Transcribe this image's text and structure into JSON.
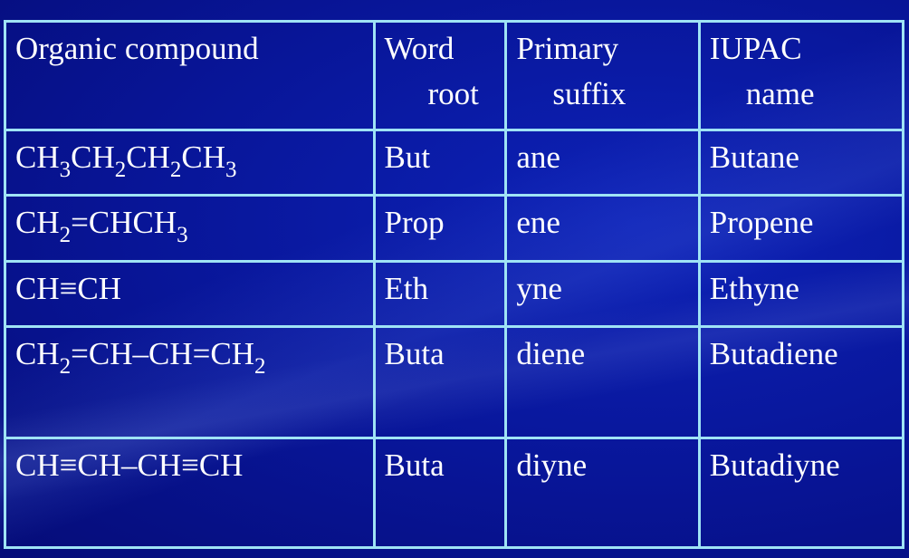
{
  "table": {
    "headers": [
      {
        "line1": "Organic compound",
        "line2": ""
      },
      {
        "line1": "Word",
        "line2": "root"
      },
      {
        "line1": "Primary",
        "line2": "suffix"
      },
      {
        "line1": "IUPAC",
        "line2": "name"
      }
    ],
    "rows": [
      {
        "compound_parts": [
          [
            "CH",
            "3"
          ],
          [
            "CH",
            "2"
          ],
          [
            "CH",
            "2"
          ],
          [
            "CH",
            "3"
          ]
        ],
        "compound_text": "CH3CH2CH2CH3",
        "word_root": "But",
        "primary_suffix": "ane",
        "iupac_name": "Butane"
      },
      {
        "compound_parts": [
          [
            "CH",
            "2"
          ],
          [
            "=CHCH",
            "3"
          ]
        ],
        "compound_text": "CH2=CHCH3",
        "word_root": "Prop",
        "primary_suffix": "ene",
        "iupac_name": "Propene"
      },
      {
        "compound_parts": [
          [
            "CH≡CH",
            ""
          ]
        ],
        "compound_text": "CH≡CH",
        "word_root": "Eth",
        "primary_suffix": "yne",
        "iupac_name": "Ethyne"
      },
      {
        "compound_parts": [
          [
            "CH",
            "2"
          ],
          [
            "=CH–CH=CH",
            "2"
          ]
        ],
        "compound_text": "CH2=CH–CH=CH2",
        "word_root": "Buta",
        "primary_suffix": "diene",
        "iupac_name": "Butadiene"
      },
      {
        "compound_parts": [
          [
            "CH≡CH–CH≡CH",
            ""
          ]
        ],
        "compound_text": "CH≡CH–CH≡CH",
        "word_root": "Buta",
        "primary_suffix": "diyne",
        "iupac_name": "Butadiyne"
      }
    ]
  },
  "colors": {
    "background": "#07118a",
    "border": "#9fe3f5",
    "text": "#ffffff"
  }
}
